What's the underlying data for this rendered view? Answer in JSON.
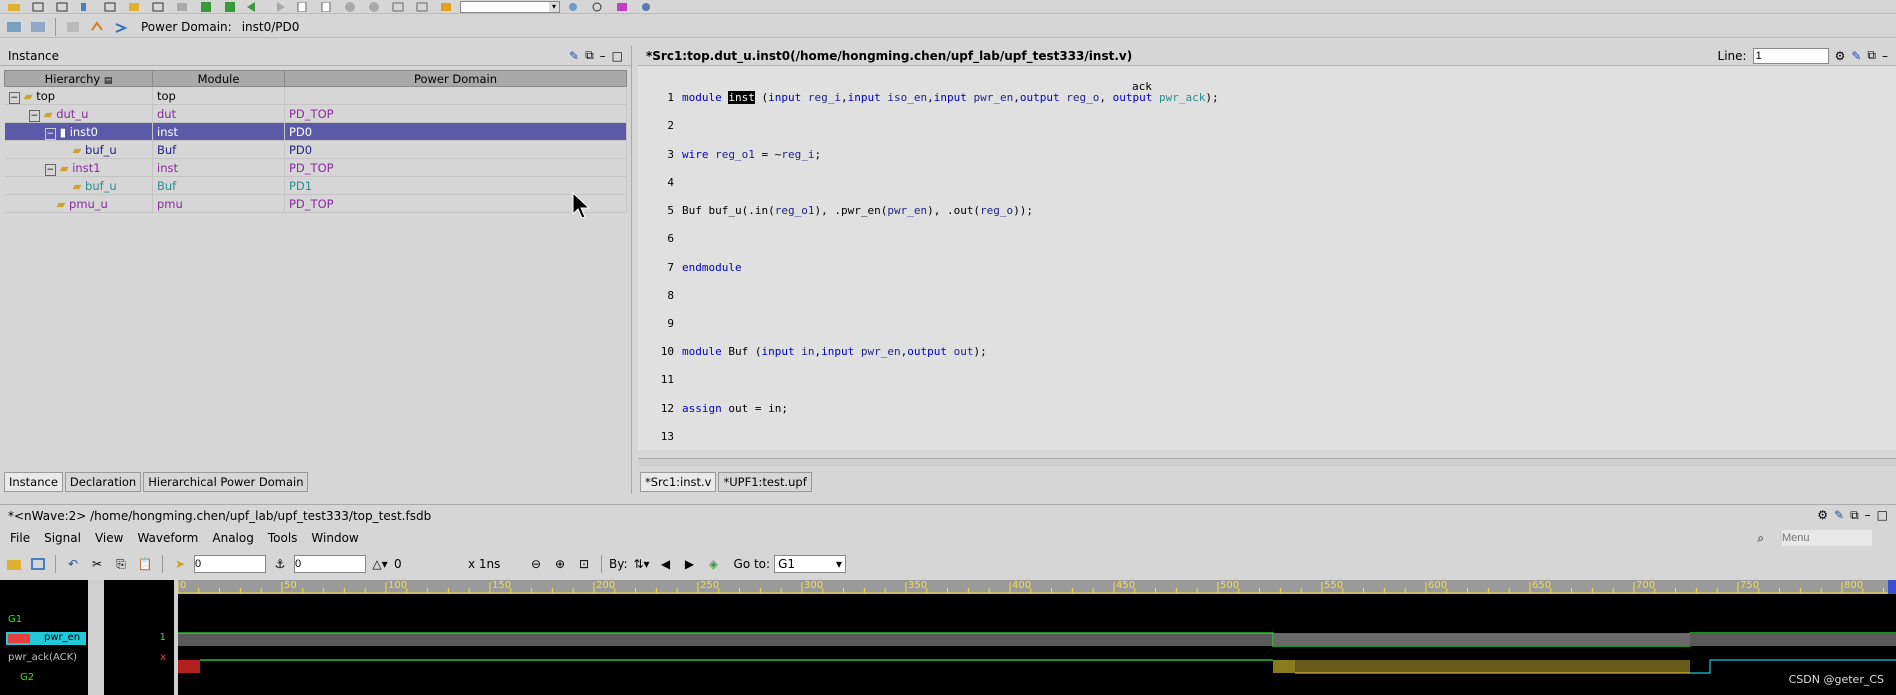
{
  "top_toolbar": {
    "power_domain_label": "Power Domain:",
    "power_domain_value": "inst0/PD0"
  },
  "instance_panel": {
    "title": "Instance",
    "columns": [
      "Hierarchy",
      "Module",
      "Power Domain"
    ],
    "rows": [
      {
        "name": "top",
        "module": "top",
        "domain": ""
      },
      {
        "name": "dut_u",
        "module": "dut",
        "domain": "PD_TOP"
      },
      {
        "name": "inst0",
        "module": "inst",
        "domain": "PD0"
      },
      {
        "name": "buf_u",
        "module": "Buf",
        "domain": "PD0"
      },
      {
        "name": "inst1",
        "module": "inst",
        "domain": "PD_TOP"
      },
      {
        "name": "buf_u",
        "module": "Buf",
        "domain": "PD1"
      },
      {
        "name": "pmu_u",
        "module": "pmu",
        "domain": "PD_TOP"
      }
    ],
    "tabs": [
      "Instance",
      "Declaration",
      "Hierarchical Power Domain"
    ]
  },
  "source_panel": {
    "title": "*Src1:top.dut_u.inst0(/home/hongming.chen/upf_lab/upf_test333/inst.v)",
    "line_label": "Line:",
    "line_value": "1",
    "tooltip": "ack",
    "tabs": [
      "*Src1:inst.v",
      "*UPF1:test.upf"
    ],
    "line_numbers": [
      "1",
      "2",
      "3",
      "4",
      "5",
      "6",
      "7",
      "8",
      "9",
      "10",
      "11",
      "12",
      "13"
    ]
  },
  "nwave": {
    "title": "*<nWave:2> /home/hongming.chen/upf_lab/upf_test333/top_test.fsdb",
    "menus": [
      "File",
      "Signal",
      "View",
      "Waveform",
      "Analog",
      "Tools",
      "Window"
    ],
    "menu_search_placeholder": "Menu",
    "cursor_value": "0",
    "marker_value": "0",
    "delta_value": "0",
    "time_unit": "x 1ns",
    "by_label": "By:",
    "goto_label": "Go to:",
    "goto_value": "G1",
    "ruler_ticks": [
      "0",
      "50",
      "100",
      "150",
      "200",
      "250",
      "300",
      "350",
      "400",
      "450",
      "500",
      "550",
      "600",
      "650",
      "700",
      "750",
      "800"
    ],
    "groups": [
      "G1",
      "G2"
    ],
    "signals": [
      {
        "name": "pwr_en",
        "value": "1"
      },
      {
        "name": "pwr_ack(ACK)",
        "value": "x"
      }
    ]
  },
  "watermark": "CSDN @geter_CS"
}
